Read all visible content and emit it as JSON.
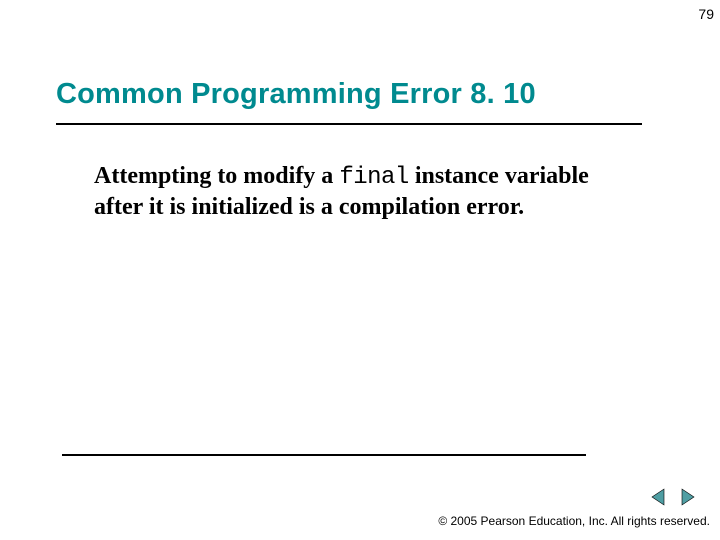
{
  "page_number": "79",
  "title": "Common Programming Error 8. 10",
  "body": {
    "pre": "Attempting to modify a ",
    "code": "final",
    "post": " instance variable after it is initialized is a compilation error."
  },
  "copyright": "© 2005 Pearson Education, Inc.  All rights reserved."
}
